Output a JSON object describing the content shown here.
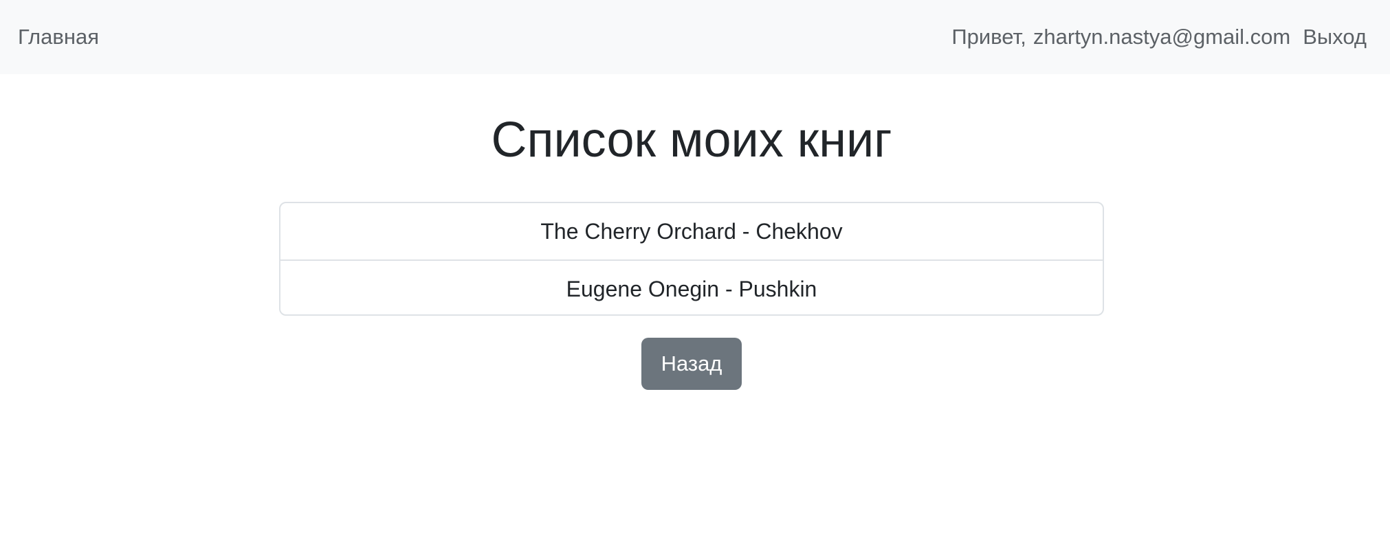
{
  "navbar": {
    "home_label": "Главная",
    "greeting_prefix": "Привет,",
    "user_email": "zhartyn.nastya@gmail.com",
    "logout_label": "Выход"
  },
  "main": {
    "title": "Список моих книг",
    "books": [
      {
        "label": "The Cherry Orchard - Chekhov"
      },
      {
        "label": "Eugene Onegin - Pushkin"
      }
    ],
    "back_label": "Назад"
  },
  "colors": {
    "navbar_bg": "#f8f9fa",
    "nav_text": "#5c6166",
    "button_bg": "#6c757d",
    "border": "#dee2e6"
  }
}
